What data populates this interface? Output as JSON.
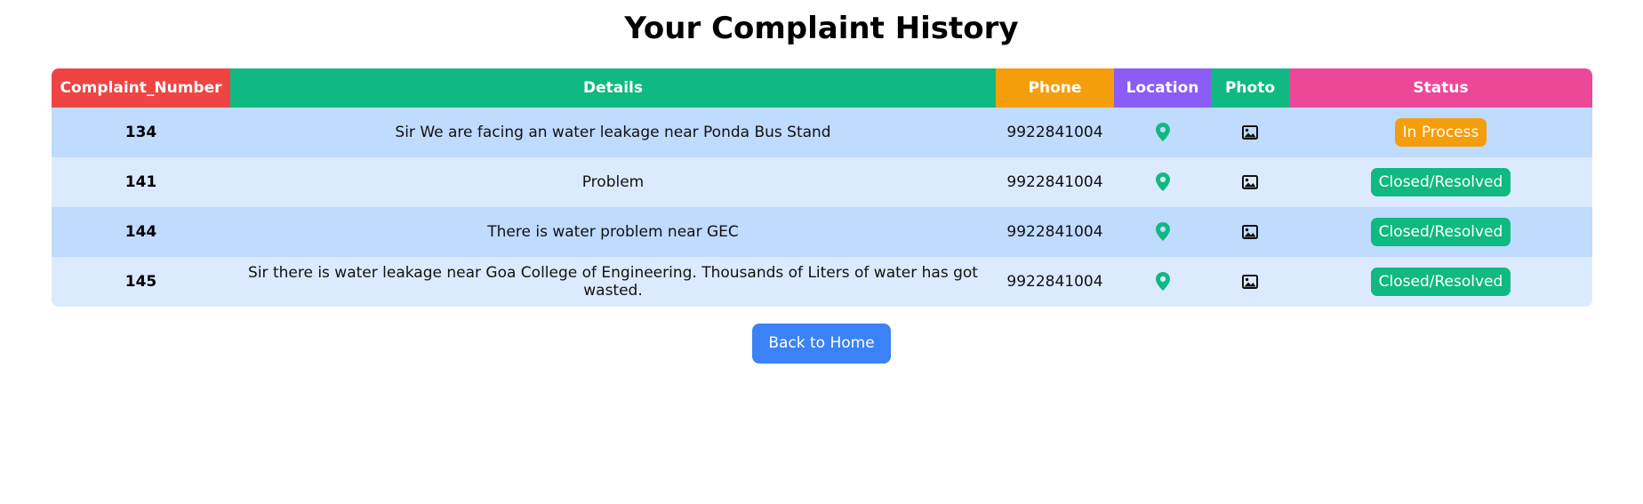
{
  "title": "Your Complaint History",
  "colors": {
    "complaint_number_header": "#ef4444",
    "details_header": "#10b981",
    "phone_header": "#f59e0b",
    "location_header": "#8b5cf6",
    "photo_header": "#10b981",
    "status_header": "#ec4899",
    "location_icon": "#10b981",
    "photo_icon": "#111111",
    "in_process": "#f59e0b",
    "closed_resolved": "#10b981",
    "back_button": "#3b82f6"
  },
  "table": {
    "headers": {
      "complaint_number": "Complaint_Number",
      "details": "Details",
      "phone": "Phone",
      "location": "Location",
      "photo": "Photo",
      "status": "Status"
    },
    "rows": [
      {
        "complaint_number": "134",
        "details": "Sir We are facing an water leakage near Ponda Bus Stand",
        "phone": "9922841004",
        "location_icon": "map-marker-icon",
        "photo_icon": "image-icon",
        "status": "In Process"
      },
      {
        "complaint_number": "141",
        "details": "Problem",
        "phone": "9922841004",
        "location_icon": "map-marker-icon",
        "photo_icon": "image-icon",
        "status": "Closed/Resolved"
      },
      {
        "complaint_number": "144",
        "details": "There is water problem near GEC",
        "phone": "9922841004",
        "location_icon": "map-marker-icon",
        "photo_icon": "image-icon",
        "status": "Closed/Resolved"
      },
      {
        "complaint_number": "145",
        "details": "Sir there is water leakage near Goa College of Engineering. Thousands of Liters of water has got wasted.",
        "phone": "9922841004",
        "location_icon": "map-marker-icon",
        "photo_icon": "image-icon",
        "status": "Closed/Resolved"
      }
    ]
  },
  "back_button_label": "Back to Home"
}
